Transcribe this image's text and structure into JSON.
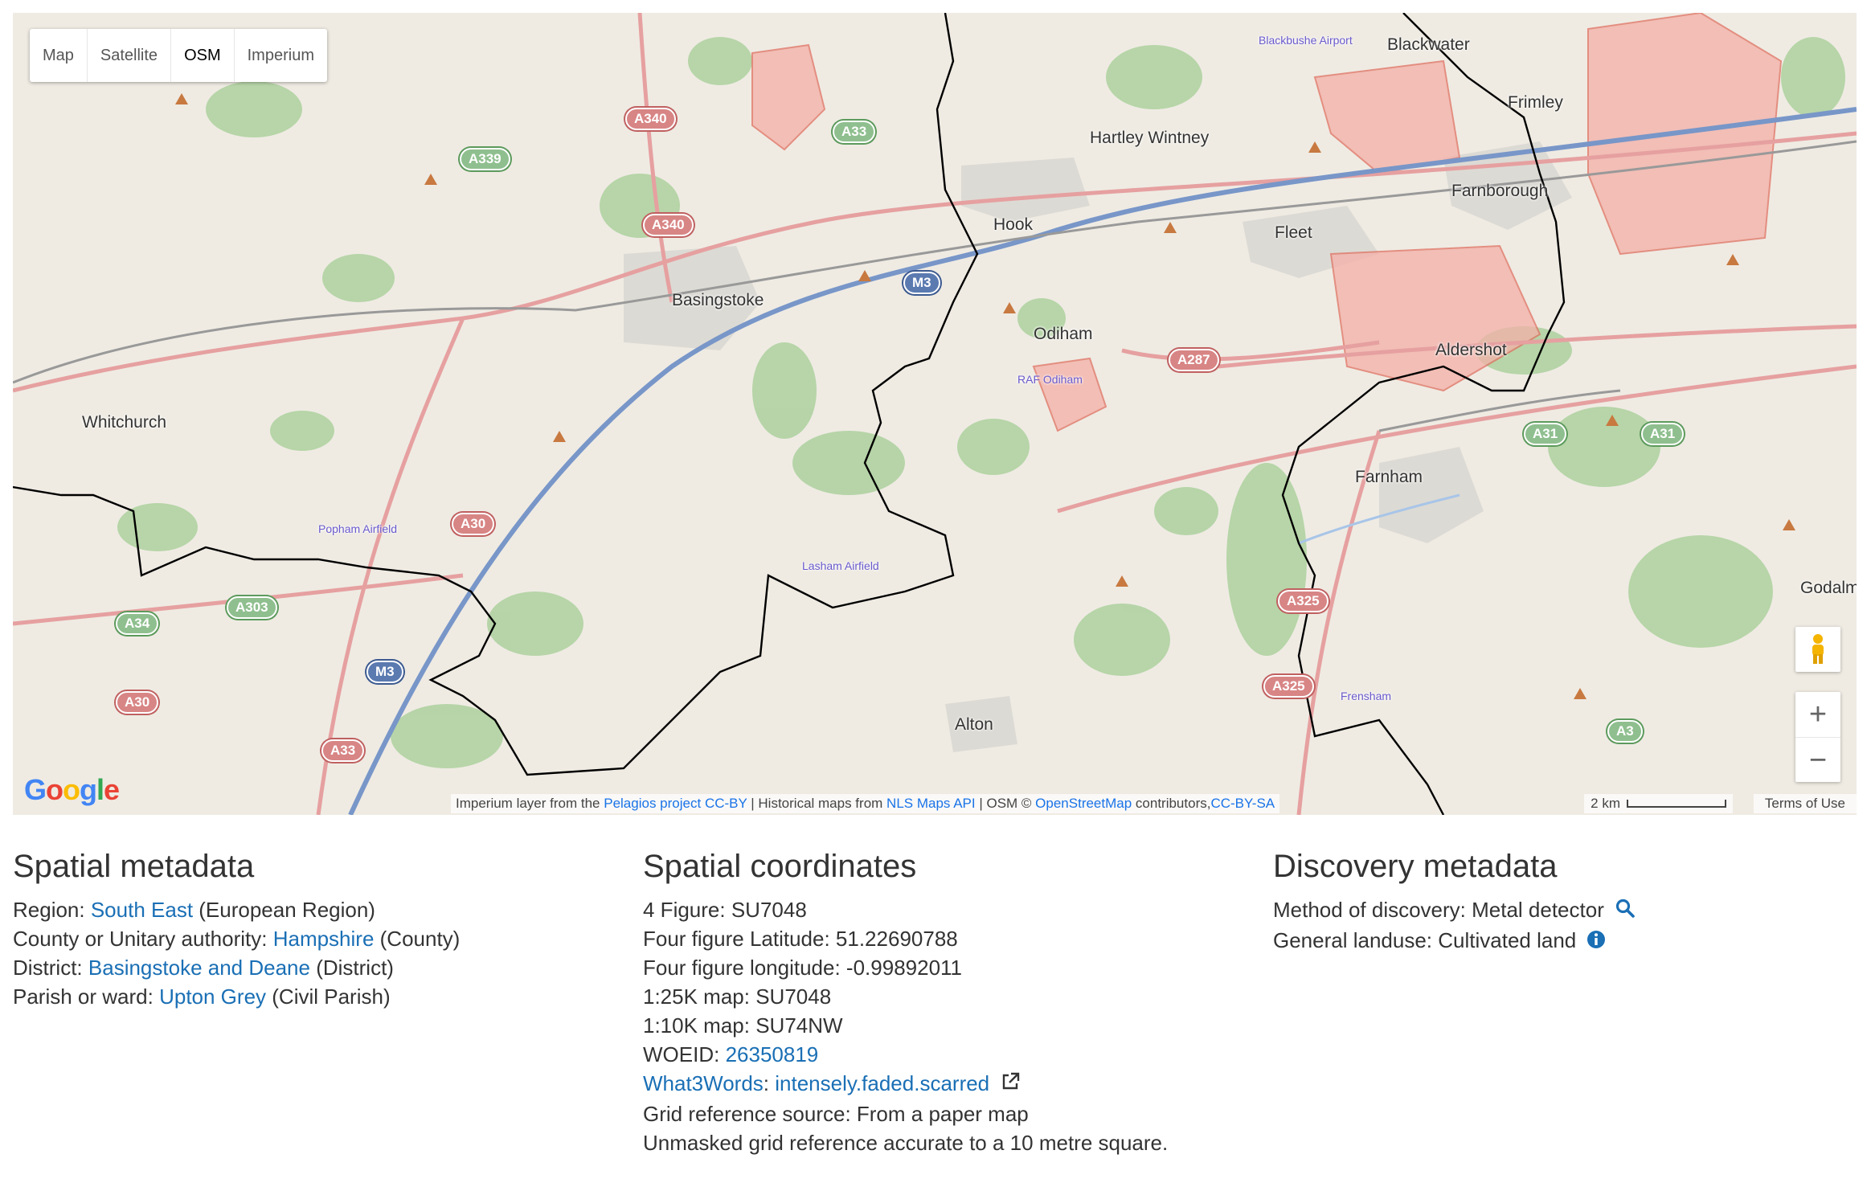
{
  "map": {
    "type_buttons": [
      "Map",
      "Satellite",
      "OSM",
      "Imperium"
    ],
    "active_type": "OSM",
    "places": [
      "Blackwater",
      "Frimley",
      "Blackbushe Airport",
      "Hartley Wintney",
      "Farnborough",
      "Hook",
      "Fleet",
      "Basingstoke",
      "Odiham",
      "RAF Odiham",
      "Aldershot",
      "Whitchurch",
      "Farnham",
      "Popham Airfield",
      "Lasham Airfield",
      "Godalmin",
      "Alton",
      "Frensham"
    ],
    "roads": [
      "A340",
      "A33",
      "A339",
      "A340",
      "M3",
      "A287",
      "A31",
      "A31",
      "A30",
      "A34",
      "A303",
      "M3",
      "A30",
      "A33",
      "A325",
      "A325",
      "A3"
    ],
    "zoom_in": "+",
    "zoom_out": "−",
    "google_logo": "Google",
    "attribution": {
      "imperium_prefix": "Imperium layer from the ",
      "pelagios_link": "Pelagios project",
      "ccby_link": "CC-BY",
      "historical_prefix": " | Historical maps from ",
      "nls_link": "NLS Maps API",
      "osm_prefix": " | OSM © ",
      "osm_link": "OpenStreetMap",
      "contributors": " contributors,",
      "ccbysa_link": "CC-BY-SA"
    },
    "scale_label": "2 km",
    "terms": "Terms of Use",
    "colors": {
      "water": "#a8c5e8",
      "wood": "#add19e",
      "urban": "#dcdad4",
      "military": "#f4a5a5"
    }
  },
  "spatial_metadata": {
    "heading": "Spatial metadata",
    "region_label": "Region: ",
    "region_value": "South East",
    "region_type": " (European Region)",
    "county_label": "County or Unitary authority: ",
    "county_value": "Hampshire",
    "county_type": " (County)",
    "district_label": "District: ",
    "district_value": "Basingstoke and Deane",
    "district_type": " (District)",
    "parish_label": "Parish or ward: ",
    "parish_value": "Upton Grey",
    "parish_type": " (Civil Parish)"
  },
  "spatial_coordinates": {
    "heading": "Spatial coordinates",
    "four_figure": "4 Figure: SU7048",
    "latitude": "Four figure Latitude: 51.22690788",
    "longitude": "Four figure longitude: -0.99892011",
    "map25k": "1:25K map: SU7048",
    "map10k": "1:10K map: SU74NW",
    "woeid_label": "WOEID: ",
    "woeid_value": "26350819",
    "w3w_label": "What3Words",
    "w3w_sep": ": ",
    "w3w_value": "intensely.faded.scarred",
    "grid_source": "Grid reference source: From a paper map",
    "unmasked": "Unmasked grid reference accurate to a 10 metre square."
  },
  "discovery_metadata": {
    "heading": "Discovery metadata",
    "method": "Method of discovery: Metal detector",
    "landuse": "General landuse: Cultivated land"
  }
}
